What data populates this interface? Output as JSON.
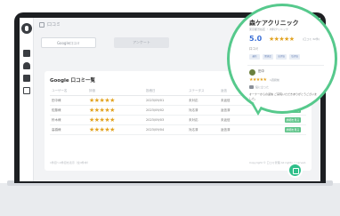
{
  "breadcrumb": "口コミ",
  "tabs": [
    "Google口コミ",
    "アンケート"
  ],
  "review_table": {
    "title": "Google 口コミ一覧",
    "columns": [
      "ユーザー名",
      "評価",
      "投稿日",
      "ステータス",
      "返信",
      ""
    ],
    "rows": [
      {
        "user": "田中様",
        "stars": "★★★★★",
        "date": "2023/09/01",
        "status": "未対応",
        "reply": "未返信",
        "action": "詳細を見る"
      },
      {
        "user": "佐藤様",
        "stars": "★★★★★",
        "date": "2023/09/02",
        "status": "対応済",
        "reply": "返信済",
        "action": "詳細を見る"
      },
      {
        "user": "鈴木様",
        "stars": "★★★★★",
        "date": "2023/09/03",
        "status": "未対応",
        "reply": "未返信",
        "action": "詳細を見る"
      },
      {
        "user": "高橋様",
        "stars": "★★★★★",
        "date": "2023/09/04",
        "status": "対応済",
        "reply": "返信済",
        "action": "詳細を見る"
      }
    ],
    "footer_left": "1件目～4件目を表示（全4件中）",
    "footer_right": "Copyright © 口コミ管理 All rights reserved."
  },
  "store_panel": {
    "name": "森ケアクリニック",
    "subtitle": "東京都渋谷区 ・ 内科クリニック",
    "score": "5.0",
    "stars": "★★★★★",
    "count": "(口コミ 32件)",
    "label": "口コミ",
    "chips": [
      "最新",
      "関連度",
      "高評価",
      "低評価"
    ],
    "reviewer": "田中",
    "review_stars": "★★★★★",
    "review_date": "1週間前",
    "likes": "役に立った",
    "reply": "オーナーからの返信 ご来院いただきありがとうございました。"
  }
}
